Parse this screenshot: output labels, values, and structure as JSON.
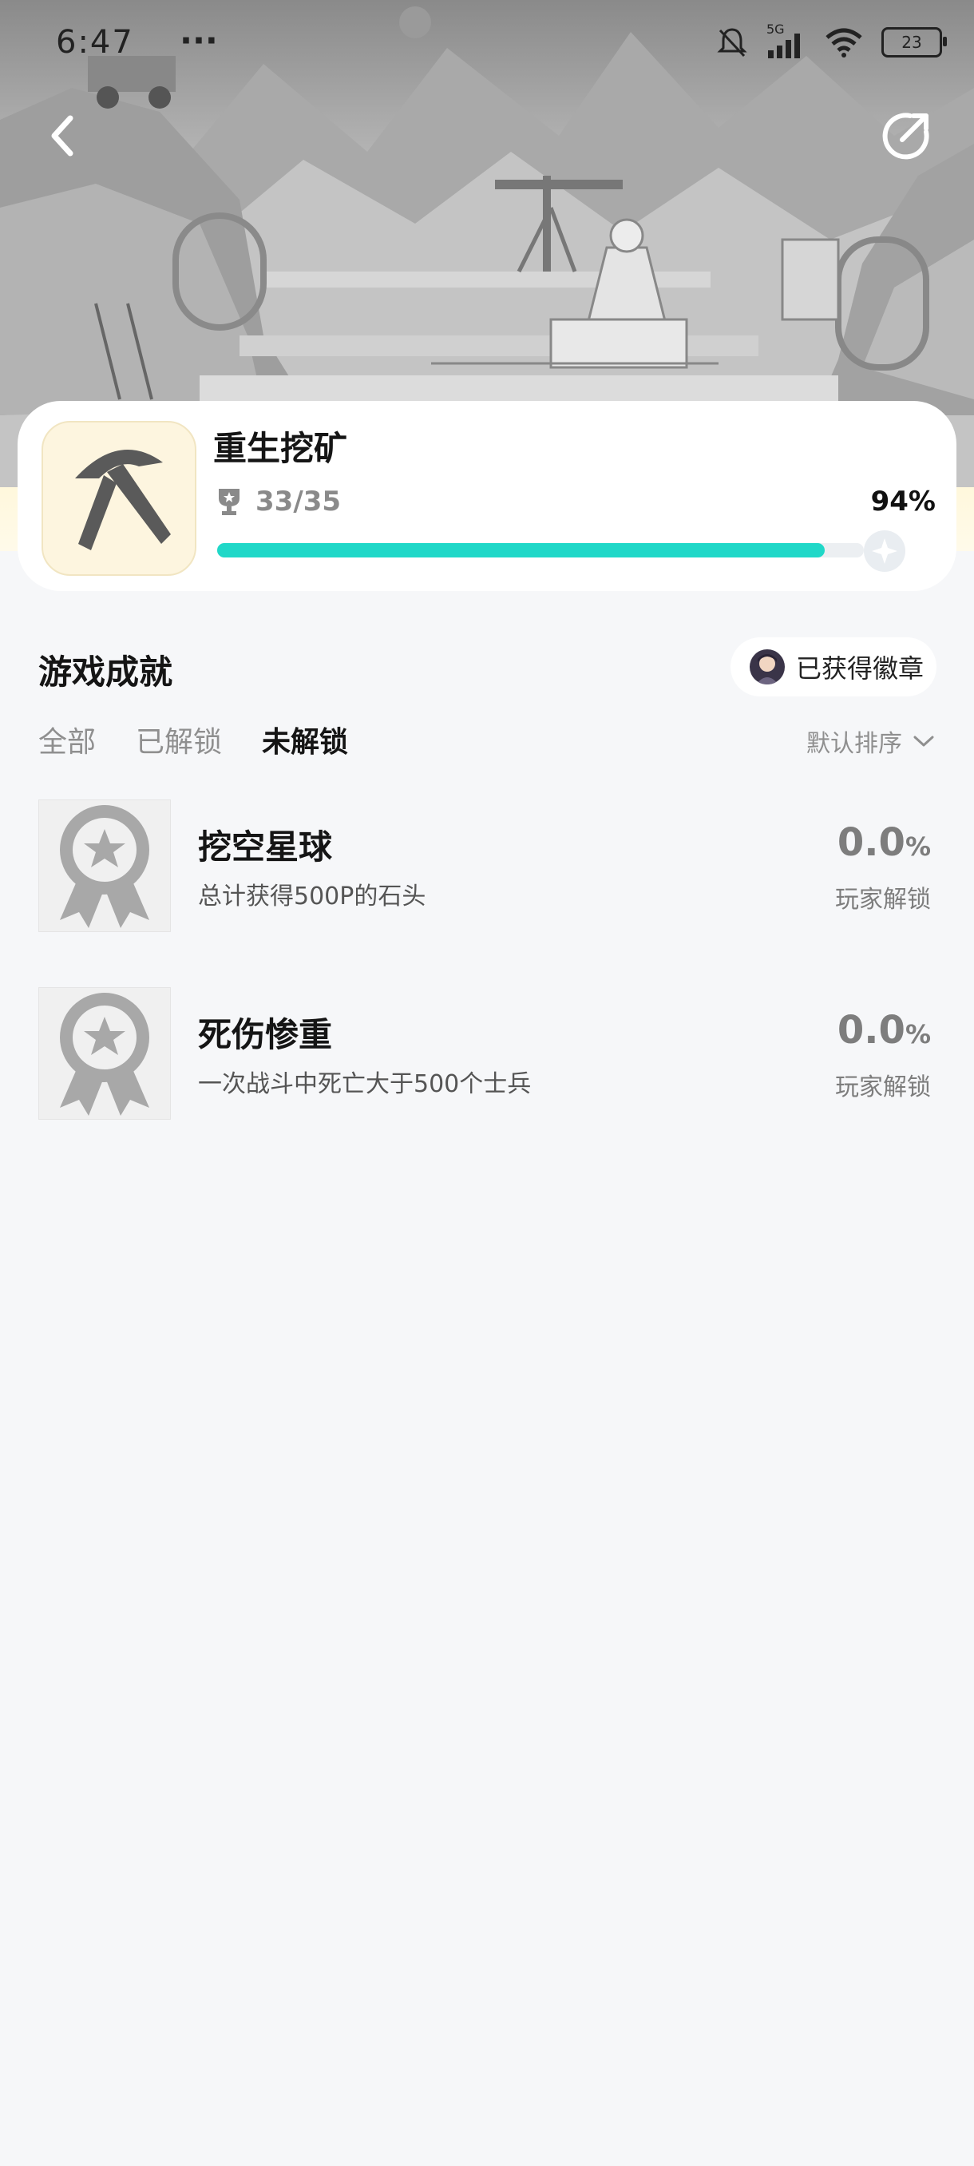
{
  "status_bar": {
    "time": "6:47",
    "more": "···",
    "network": "5G",
    "battery": "23"
  },
  "game": {
    "title": "重生挖矿",
    "achievement_count": "33/35",
    "percent": "94%",
    "progress": 0.94
  },
  "section": {
    "title": "游戏成就",
    "badge_button": "已获得徽章"
  },
  "tabs": [
    {
      "label": "全部",
      "active": false
    },
    {
      "label": "已解锁",
      "active": false
    },
    {
      "label": "未解锁",
      "active": true
    }
  ],
  "sort": {
    "label": "默认排序"
  },
  "achievements": [
    {
      "name": "挖空星球",
      "desc": "总计获得500P的石头",
      "rate": "0.0",
      "unit": "%",
      "rate_label": "玩家解锁"
    },
    {
      "name": "死伤惨重",
      "desc": "一次战斗中死亡大于500个士兵",
      "rate": "0.0",
      "unit": "%",
      "rate_label": "玩家解锁"
    }
  ],
  "colors": {
    "accent": "#20d8c8",
    "background": "#f6f7f9",
    "card_icon_bg": "#fdf5df"
  }
}
